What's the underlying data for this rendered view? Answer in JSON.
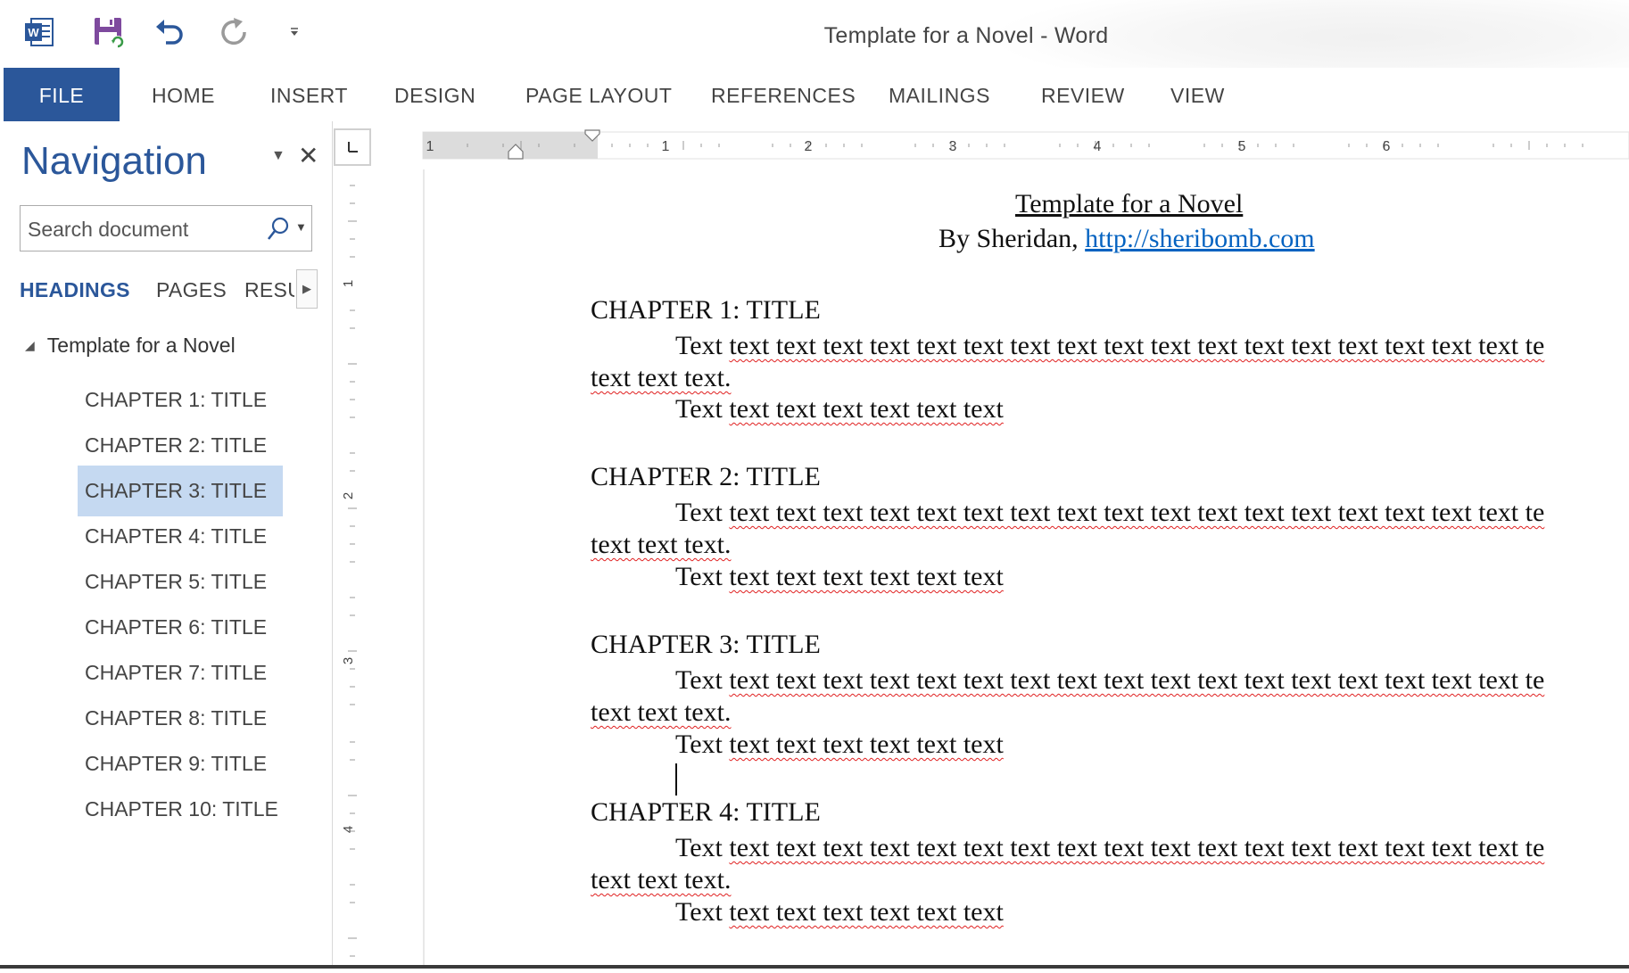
{
  "window": {
    "title": "Template for a Novel - Word"
  },
  "quick_access": {
    "icons": [
      "word-app-icon",
      "save-icon",
      "undo-icon",
      "redo-icon",
      "customize-qat-icon"
    ]
  },
  "ribbon": {
    "tabs": [
      "FILE",
      "HOME",
      "INSERT",
      "DESIGN",
      "PAGE LAYOUT",
      "REFERENCES",
      "MAILINGS",
      "REVIEW",
      "VIEW"
    ],
    "active_tab": "FILE",
    "accent_color": "#2b579a"
  },
  "navigation": {
    "title": "Navigation",
    "search_placeholder": "Search document",
    "tabs": [
      "HEADINGS",
      "PAGES",
      "RESU"
    ],
    "active_tab": "HEADINGS",
    "root_heading": "Template for a Novel",
    "headings": [
      "CHAPTER 1: TITLE",
      "CHAPTER 2: TITLE",
      "CHAPTER 3: TITLE",
      "CHAPTER 4: TITLE",
      "CHAPTER 5: TITLE",
      "CHAPTER 6: TITLE",
      "CHAPTER 7: TITLE",
      "CHAPTER 8: TITLE",
      "CHAPTER 9: TITLE",
      "CHAPTER 10: TITLE"
    ],
    "selected_heading": "CHAPTER 3: TITLE"
  },
  "rulers": {
    "horizontal_labels": [
      "1",
      "1",
      "2",
      "3",
      "4",
      "5",
      "6"
    ],
    "vertical_labels": [
      "1",
      "2",
      "3",
      "4"
    ]
  },
  "document": {
    "title": "Template for a Novel",
    "byline_prefix": "By Sheridan, ",
    "byline_link": "http://sheribomb.com",
    "chapters": [
      {
        "heading": "CHAPTER 1:  TITLE",
        "line1_first": "Text",
        "line1_rest": "text text text text text text text text text text text text text text text text text te",
        "line2": "text text text.",
        "line3_first": "Text",
        "line3_rest": "text text text text text text"
      },
      {
        "heading": "CHAPTER 2:  TITLE",
        "line1_first": "Text",
        "line1_rest": "text text text text text text text text text text text text text text text text text te",
        "line2": "text text text.",
        "line3_first": "Text",
        "line3_rest": "text text text text text text"
      },
      {
        "heading": "CHAPTER 3:  TITLE",
        "line1_first": "Text",
        "line1_rest": "text text text text text text text text text text text text text text text text text te",
        "line2": "text text text.",
        "line3_first": "Text",
        "line3_rest": "text text text text text text"
      },
      {
        "heading": "CHAPTER 4:  TITLE",
        "line1_first": "Text",
        "line1_rest": "text text text text text text text text text text text text text text text text text te",
        "line2": "text text text.",
        "line3_first": "Text",
        "line3_rest": "text text text text text text"
      }
    ]
  }
}
